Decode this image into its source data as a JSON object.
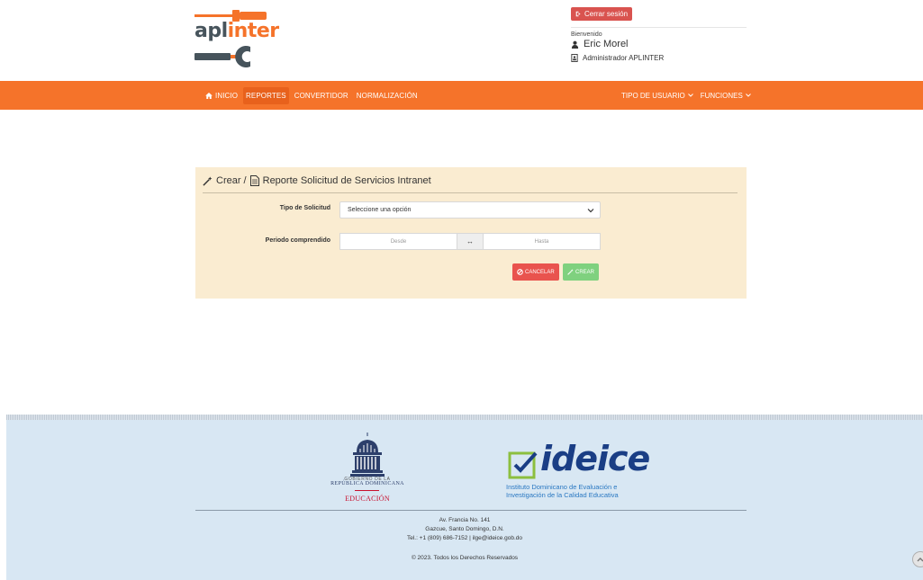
{
  "brand": {
    "name_part1": "apl",
    "name_part2": "inter"
  },
  "user": {
    "logout_label": "Cerrar sesión",
    "welcome": "Bienvenido",
    "name": "Eric Morel",
    "role": "Administrador APLINTER"
  },
  "nav": {
    "items": [
      {
        "label": "INICIO",
        "icon": "home-icon"
      },
      {
        "label": "REPORTES",
        "active": true
      },
      {
        "label": "CONVERTIDOR"
      },
      {
        "label": "NORMALIZACIÓN"
      }
    ],
    "dropdowns": [
      {
        "label": "TIPO DE USUARIO"
      },
      {
        "label": "FUNCIONES"
      }
    ]
  },
  "form": {
    "breadcrumb_crear": "Crear /",
    "title": "Reporte Solicitud de Servicios Intranet",
    "tipo_label": "Tipo de Solicitud",
    "tipo_value": "Seleccione una opción",
    "periodo_label": "Periodo comprendido",
    "desde_placeholder": "Desde",
    "separator": "↔",
    "hasta_placeholder": "Hasta",
    "cancel_label": "CANCELAR",
    "create_label": "CREAR"
  },
  "footer": {
    "gov_line1": "GOBIERNO DE LA",
    "gov_line2": "REPÚBLICA DOMINICANA",
    "gov_line3": "EDUCACIÓN",
    "ideice_word": "ideice",
    "ideice_sub1": "Instituto Dominicano de Evaluación e",
    "ideice_sub2": "Investigación de la Calidad Educativa",
    "address1": "Av. Francia No. 141",
    "address2": "Gazcue, Santo Domingo, D.N.",
    "address3": "Tel.: +1 (809) 686-7152 | ilge@ideice.gob.do",
    "copyright": "© 2023. Todos los Derechos Reservados"
  },
  "colors": {
    "brand_orange": "#f5732a",
    "panel_bg": "#faecd1",
    "danger": "#d9534f",
    "success": "#7fd17f",
    "footer_bg": "#d8e7f3"
  }
}
